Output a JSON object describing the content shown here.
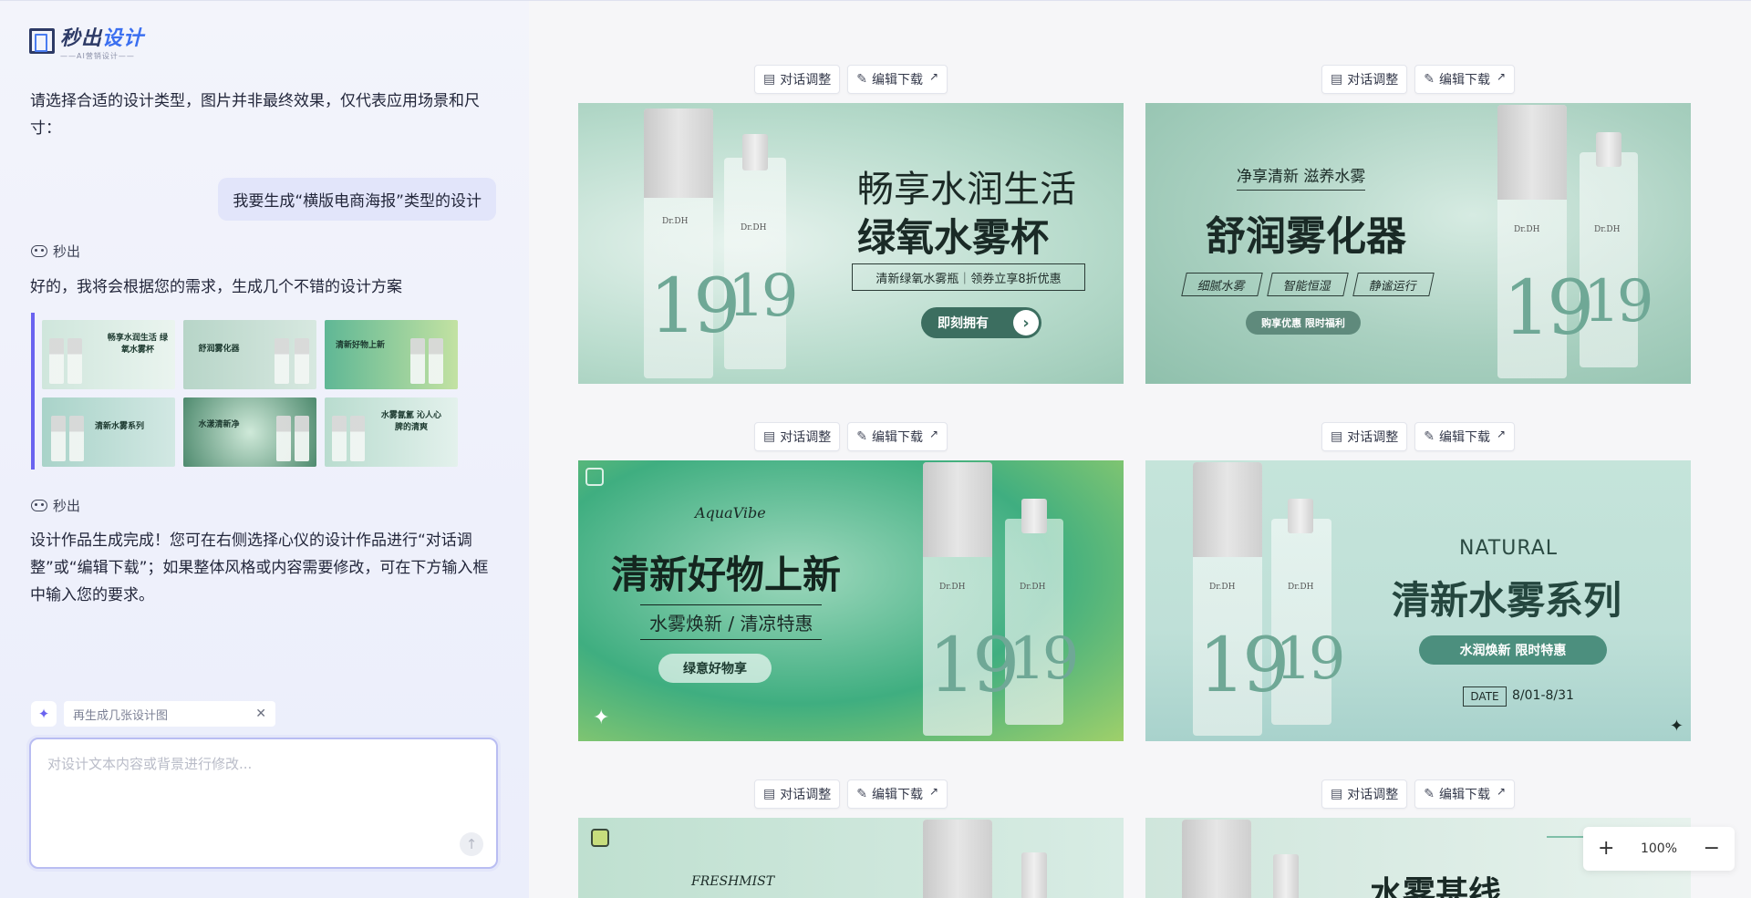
{
  "brand": {
    "name_a": "秒出",
    "name_b": "设计",
    "tagline": "——AI营销设计——"
  },
  "chat": {
    "intro": "请选择合适的设计类型，图片并非最终效果，仅代表应用场景和尺寸：",
    "user_message": "我要生成“横版电商海报”类型的设计",
    "sender_name": "秒出",
    "reply_1": "好的，我将会根据您的需求，生成几个不错的设计方案",
    "reply_2": "设计作品生成完成！您可在右侧选择心仪的设计作品进行“对话调整”或“编辑下载”；如果整体风格或内容需要修改，可在下方输入框中输入您的要求。",
    "thumbnails": [
      {
        "title": "畅享水润生活 绿氧水雾杯"
      },
      {
        "title": "舒润雾化器"
      },
      {
        "title": "清新好物上新"
      },
      {
        "title": "清新水雾系列"
      },
      {
        "title": "水漾清新净"
      },
      {
        "title": "水雾氤氲 沁人心脾的清爽"
      }
    ],
    "suggestion_chip": "再生成几张设计图",
    "input_placeholder": "对设计文本内容或背景进行修改..."
  },
  "card_actions": {
    "chat_adjust": "对话调整",
    "edit_download": "编辑下载"
  },
  "posters": [
    {
      "headline_1": "畅享水润生活",
      "headline_2": "绿氧水雾杯",
      "tagline": "清新绿氧水雾瓶｜领券立享8折优惠",
      "button": "即刻拥有",
      "brand": "Dr.DH"
    },
    {
      "kicker": "净享清新 滋养水雾",
      "headline": "舒润雾化器",
      "features": [
        "细腻水雾",
        "智能恒湿",
        "静谧运行"
      ],
      "button": "购享优惠 限时福利",
      "brand": "Dr.DH"
    },
    {
      "script": "AquaVibe",
      "headline": "清新好物上新",
      "subline": "水雾焕新 / 清凉特惠",
      "button": "绿意好物享",
      "brand": "Dr.DH"
    },
    {
      "kicker": "NATURAL",
      "headline": "清新水雾系列",
      "button": "水润焕新 限时特惠",
      "date_label": "DATE",
      "date_value": "8/01-8/31",
      "brand": "Dr.DH"
    },
    {
      "script": "FRESHMIST"
    },
    {
      "headline": "水雾甚线"
    }
  ],
  "zoom": {
    "level": "100%",
    "plus": "+",
    "minus": "−"
  },
  "colors": {
    "accent": "#6a63f0",
    "mint": "#7fbfa8",
    "dark_green": "#3c6e60"
  }
}
